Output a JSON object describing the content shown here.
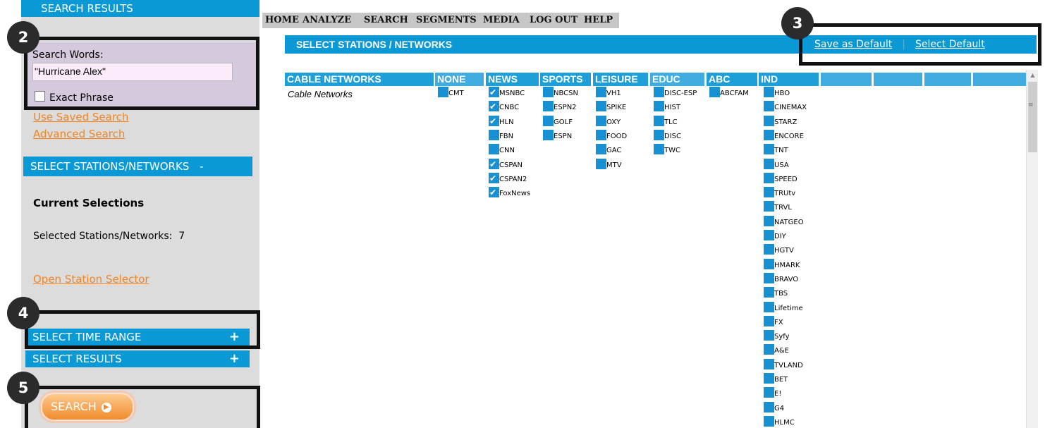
{
  "sidebar": {
    "title": "SEARCH RESULTS",
    "search_words_label": "Search Words:",
    "search_value": "\"Hurricane Alex\"",
    "exact_phrase_label": "Exact Phrase",
    "use_saved_search": "Use Saved Search",
    "advanced_search": "Advanced Search",
    "stations_header": "SELECT STATIONS/NETWORKS",
    "stations_toggle": "-",
    "current_selections": "Current Selections",
    "selected_label": "Selected Stations/Networks:",
    "selected_count": "7",
    "open_station_selector": "Open Station Selector",
    "time_range_header": "SELECT TIME RANGE",
    "time_range_toggle": "+",
    "results_header": "SELECT RESULTS",
    "results_toggle": "+",
    "search_button": "SEARCH"
  },
  "callouts": [
    "2",
    "3",
    "4",
    "5"
  ],
  "nav": [
    "HOME",
    "ANALYZE",
    "SEARCH",
    "SEGMENTS",
    "MEDIA",
    "LOG OUT",
    "HELP"
  ],
  "main": {
    "title": "SELECT STATIONS / NETWORKS",
    "save_default": "Save as Default",
    "separator": "|",
    "select_default": "Select Default",
    "group_label": "Cable Networks",
    "columns": [
      {
        "header": "CABLE NETWORKS",
        "stations": []
      },
      {
        "header": "NONE",
        "stations": [
          {
            "name": "CMT",
            "checked": false
          }
        ]
      },
      {
        "header": "NEWS",
        "stations": [
          {
            "name": "MSNBC",
            "checked": true
          },
          {
            "name": "CNBC",
            "checked": true
          },
          {
            "name": "HLN",
            "checked": true
          },
          {
            "name": "FBN",
            "checked": false
          },
          {
            "name": "CNN",
            "checked": false
          },
          {
            "name": "CSPAN",
            "checked": true
          },
          {
            "name": "CSPAN2",
            "checked": true
          },
          {
            "name": "FoxNews",
            "checked": true
          }
        ]
      },
      {
        "header": "SPORTS",
        "stations": [
          {
            "name": "NBCSN",
            "checked": false
          },
          {
            "name": "ESPN2",
            "checked": false
          },
          {
            "name": "GOLF",
            "checked": false
          },
          {
            "name": "ESPN",
            "checked": false
          }
        ]
      },
      {
        "header": "LEISURE",
        "stations": [
          {
            "name": "VH1",
            "checked": false
          },
          {
            "name": "SPIKE",
            "checked": false
          },
          {
            "name": "OXY",
            "checked": false
          },
          {
            "name": "FOOD",
            "checked": false
          },
          {
            "name": "GAC",
            "checked": false
          },
          {
            "name": "MTV",
            "checked": false
          }
        ]
      },
      {
        "header": "EDUC",
        "stations": [
          {
            "name": "DISC-ESP",
            "checked": false
          },
          {
            "name": "HIST",
            "checked": false
          },
          {
            "name": "TLC",
            "checked": false
          },
          {
            "name": "DISC",
            "checked": false
          },
          {
            "name": "TWC",
            "checked": false
          }
        ]
      },
      {
        "header": "ABC",
        "stations": [
          {
            "name": "ABCFAM",
            "checked": false
          }
        ]
      },
      {
        "header": "IND",
        "stations": [
          {
            "name": "HBO",
            "checked": false
          },
          {
            "name": "CINEMAX",
            "checked": false
          },
          {
            "name": "STARZ",
            "checked": false
          },
          {
            "name": "ENCORE",
            "checked": false
          },
          {
            "name": "TNT",
            "checked": false
          },
          {
            "name": "USA",
            "checked": false
          },
          {
            "name": "SPEED",
            "checked": false
          },
          {
            "name": "TRUtv",
            "checked": false
          },
          {
            "name": "TRVL",
            "checked": false
          },
          {
            "name": "NATGEO",
            "checked": false
          },
          {
            "name": "DIY",
            "checked": false
          },
          {
            "name": "HGTV",
            "checked": false
          },
          {
            "name": "HMARK",
            "checked": false
          },
          {
            "name": "BRAVO",
            "checked": false
          },
          {
            "name": "TBS",
            "checked": false
          },
          {
            "name": "Lifetime",
            "checked": false
          },
          {
            "name": "FX",
            "checked": false
          },
          {
            "name": "Syfy",
            "checked": false
          },
          {
            "name": "A&E",
            "checked": false
          },
          {
            "name": "TVLAND",
            "checked": false
          },
          {
            "name": "BET",
            "checked": false
          },
          {
            "name": "E!",
            "checked": false
          },
          {
            "name": "G4",
            "checked": false
          },
          {
            "name": "HLMC",
            "checked": false
          }
        ]
      },
      {
        "header": "",
        "stations": []
      },
      {
        "header": "",
        "stations": []
      },
      {
        "header": "",
        "stations": []
      },
      {
        "header": "",
        "stations": []
      }
    ]
  },
  "colors": {
    "accent": "#0b99d6",
    "link": "#f5841f",
    "checkbox": "#1891d3",
    "sidebar_bg": "#dcdcdc",
    "search_bg": "#d5cadd"
  }
}
